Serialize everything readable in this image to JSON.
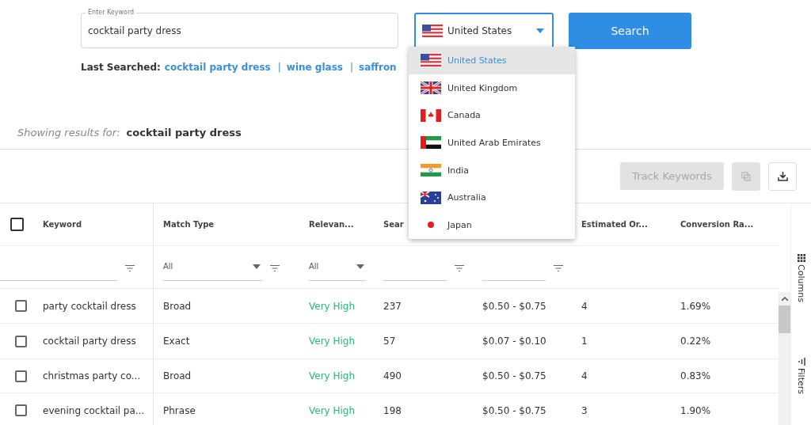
{
  "keyword_field": {
    "label": "Enter Keyword",
    "value": "cocktail party dress"
  },
  "country_select": {
    "value": "United States",
    "expanded": true
  },
  "search_button": "Search",
  "last_searched": {
    "label": "Last Searched:",
    "links": [
      "cocktail party dress",
      "wine glass",
      "saffron"
    ],
    "separator": "|"
  },
  "results": {
    "label": "Showing results for:",
    "query": "cocktail party dress"
  },
  "countries": [
    {
      "name": "United States",
      "selected": true
    },
    {
      "name": "United Kingdom",
      "selected": false
    },
    {
      "name": "Canada",
      "selected": false
    },
    {
      "name": "United Arab Emirates",
      "selected": false
    },
    {
      "name": "India",
      "selected": false
    },
    {
      "name": "Australia",
      "selected": false
    },
    {
      "name": "Japan",
      "selected": false
    }
  ],
  "toolbar": {
    "track_button": {
      "label": "Track Keywords",
      "disabled": true
    },
    "copy_disabled": true
  },
  "table": {
    "select_all_checked": false,
    "columns": [
      {
        "label": "Keyword",
        "kind": "text"
      },
      {
        "label": "Match Type",
        "kind": "select",
        "value": "All"
      },
      {
        "label": "Relevan...",
        "kind": "plainselect",
        "value": "All"
      },
      {
        "label": "Sear",
        "kind": "text"
      },
      {
        "kind": "text"
      },
      {
        "label": "Estimated Or...",
        "kind": "none"
      },
      {
        "label": "Conversion Ra...",
        "kind": "none"
      }
    ],
    "rows": [
      {
        "checked": false,
        "cells": [
          "party cocktail dress",
          "Broad",
          "Very High",
          "237",
          "$0.50 - $0.75",
          "4",
          "1.69%"
        ]
      },
      {
        "checked": false,
        "cells": [
          "cocktail party dress",
          "Exact",
          "Very High",
          "57",
          "$0.07 - $0.10",
          "1",
          "0.22%"
        ]
      },
      {
        "checked": false,
        "cells": [
          "christmas party co...",
          "Broad",
          "Very High",
          "490",
          "$0.50 - $0.75",
          "4",
          "0.83%"
        ]
      },
      {
        "checked": false,
        "cells": [
          "evening cocktail pa...",
          "Phrase",
          "Very High",
          "198",
          "$0.50 - $0.75",
          "3",
          "1.90%"
        ]
      }
    ]
  },
  "side_panel": [
    "Columns",
    "Filters"
  ]
}
